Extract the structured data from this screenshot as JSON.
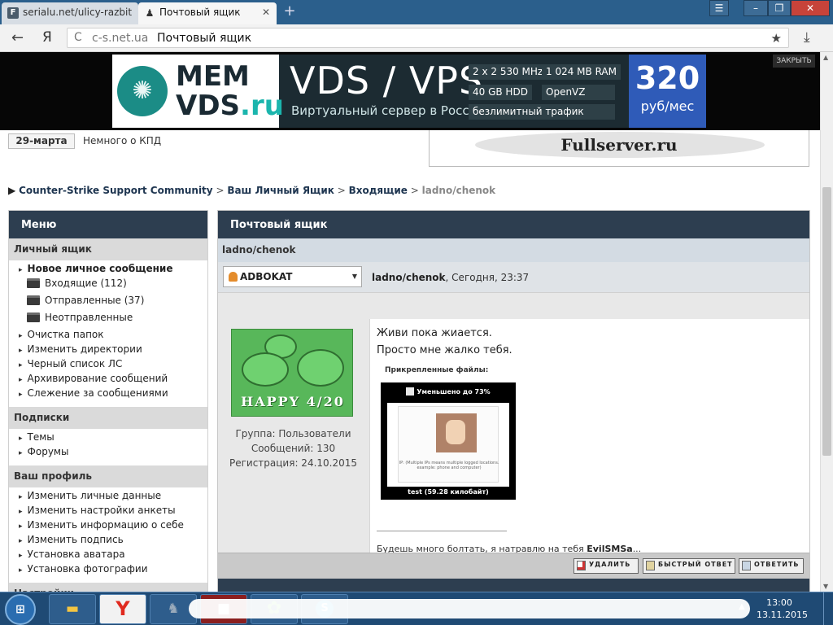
{
  "browser": {
    "tabs": [
      {
        "label": "serialu.net/ulicy-razbit",
        "icon": "F"
      },
      {
        "label": "Почтовый ящик",
        "icon": "♟"
      }
    ],
    "new_tab": "+",
    "window_buttons": {
      "menu": "☰",
      "minimize": "–",
      "maximize": "❐",
      "close": "✕"
    },
    "back": "←",
    "yandex": "Я",
    "reload": "C",
    "url_domain": "c-s.net.ua",
    "url_title": "Почтовый ящик",
    "bookmark": "★",
    "download": "⤓"
  },
  "ad": {
    "brand_top": "MEM",
    "brand_bottom_main": "VDS",
    "brand_bottom_tld": ".ru",
    "headline": "VDS / VPS",
    "subtitle": "Виртуальный сервер в России",
    "specs": [
      "2 x 2 530 MHz",
      "1 024 MB RAM",
      "40 GB HDD",
      "OpenVZ",
      "безлимитный трафик"
    ],
    "price": "320",
    "price_unit": "руб/мес",
    "close": "ЗАКРЫТЬ"
  },
  "news": {
    "date": "29-марта",
    "text": "Немного о КПД"
  },
  "right_ad": {
    "text": "Fullserver.ru"
  },
  "breadcrumb": {
    "marker": "▶",
    "items": [
      "Counter-Strike Support Community",
      "Ваш Личный Ящик",
      "Входящие"
    ],
    "current": "ladno/chenok",
    "sep": " > "
  },
  "sidebar": {
    "title": "Меню",
    "sections": [
      {
        "title": "Личный ящик"
      },
      {
        "title": "Подписки"
      },
      {
        "title": "Ваш профиль"
      },
      {
        "title": "Настройки"
      }
    ],
    "mailbox": {
      "new_message": "Новое личное сообщение",
      "folders": [
        "Входящие (112)",
        "Отправленные (37)",
        "Неотправленные"
      ],
      "items": [
        "Очистка папок",
        "Изменить директории",
        "Черный список ЛС",
        "Архивирование сообщений",
        "Слежение за сообщениями"
      ]
    },
    "subscriptions": [
      "Темы",
      "Форумы"
    ],
    "profile": [
      "Изменить личные данные",
      "Изменить настройки анкеты",
      "Изменить информацию о себе",
      "Изменить подпись",
      "Установка аватара",
      "Установка фотографии"
    ]
  },
  "main": {
    "title": "Почтовый ящик",
    "subject": "ladno/chenok",
    "author": "ADBOKAT",
    "meta_subject": "ladno/chenok",
    "meta_time": ", Сегодня, 23:37",
    "avatar_text": "HAPPY 4/20",
    "author_info": [
      "Группа: Пользователи",
      "Сообщений: 130",
      "Регистрация: 24.10.2015"
    ],
    "body_lines": [
      "Живи пока жиается.",
      "Просто мне жалко тебя."
    ],
    "attachments_label": "Прикрепленные файлы:",
    "attachment": {
      "reduced": "Уменьшено до 73%",
      "shot_text": "IP:\n(Multiple IPs means multiple logged locations. example: phone and computer)",
      "caption": "test (59.28 килобайт)"
    },
    "signature_prefix": "Будешь много болтать, я натравлю на тебя ",
    "signature_bold": "EvilSMSa",
    "signature_suffix": "...",
    "buttons": {
      "delete": "УДАЛИТЬ",
      "quick_reply": "БЫСТРЫЙ ОТВЕТ",
      "reply": "ОТВЕТИТЬ"
    }
  },
  "taskbar": {
    "start": "⊞",
    "items": [
      "explorer",
      "yandex",
      "counter-strike",
      "app-red",
      "icq",
      "skype"
    ],
    "yandex_glyph": "Y",
    "tray_arrow": "▲",
    "time": "13:00",
    "date": "13.11.2015"
  }
}
